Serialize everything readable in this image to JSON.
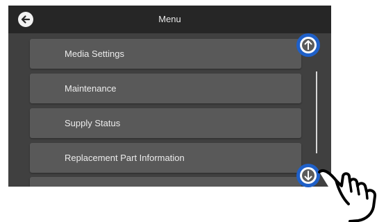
{
  "header": {
    "title": "Menu",
    "back_icon": "arrow-left-icon"
  },
  "menu": {
    "items": [
      {
        "label": "Media Settings"
      },
      {
        "label": "Maintenance"
      },
      {
        "label": "Supply Status"
      },
      {
        "label": "Replacement Part Information"
      },
      {
        "label": ""
      }
    ]
  },
  "scroll": {
    "up_icon": "arrow-up-icon",
    "down_icon": "arrow-down-icon",
    "highlight_color": "#1f60c8"
  },
  "pointer": {
    "icon": "pointing-hand-icon"
  }
}
